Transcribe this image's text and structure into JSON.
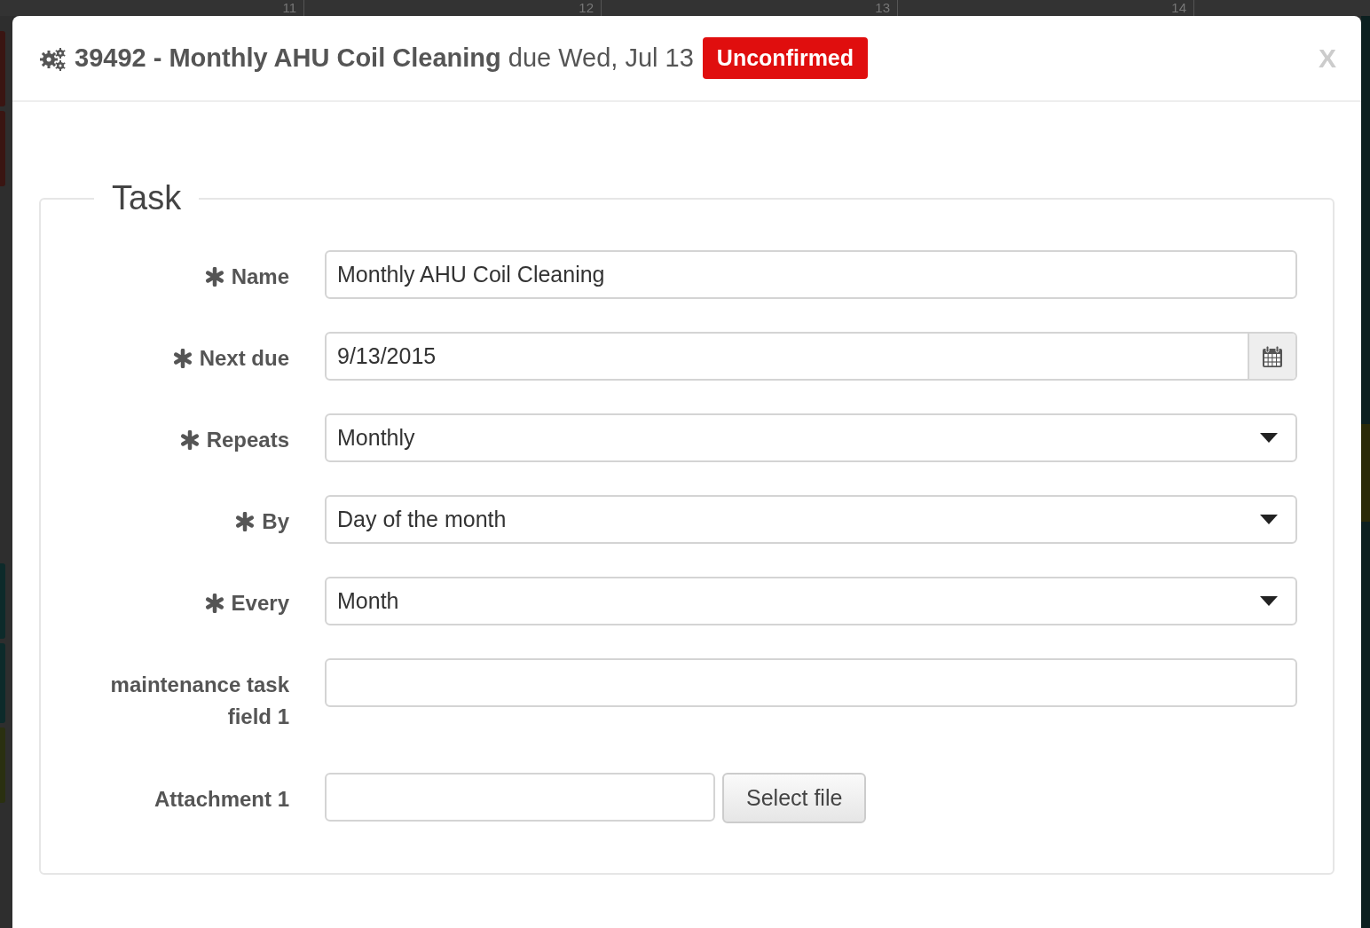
{
  "calendar_header": {
    "day_numbers": [
      "11",
      "12",
      "13",
      "14"
    ]
  },
  "modal": {
    "task_id": "39492",
    "title": "Monthly AHU Coil Cleaning",
    "separator": "-",
    "due_text": "due Wed, Jul 13",
    "status_badge": "Unconfirmed",
    "close": "X"
  },
  "fieldset": {
    "legend": "Task",
    "fields": [
      {
        "kind": "text",
        "label": "Name",
        "required": true,
        "value": "Monthly AHU Coil Cleaning"
      },
      {
        "kind": "date",
        "label": "Next due",
        "required": true,
        "value": "9/13/2015"
      },
      {
        "kind": "select",
        "label": "Repeats",
        "required": true,
        "value": "Monthly"
      },
      {
        "kind": "select",
        "label": "By",
        "required": true,
        "value": "Day of the month"
      },
      {
        "kind": "select",
        "label": "Every",
        "required": true,
        "value": "Month"
      },
      {
        "kind": "text",
        "label": "maintenance task field 1",
        "required": false
      },
      {
        "kind": "file",
        "label": "Attachment 1",
        "required": false,
        "button": "Select file"
      }
    ]
  }
}
